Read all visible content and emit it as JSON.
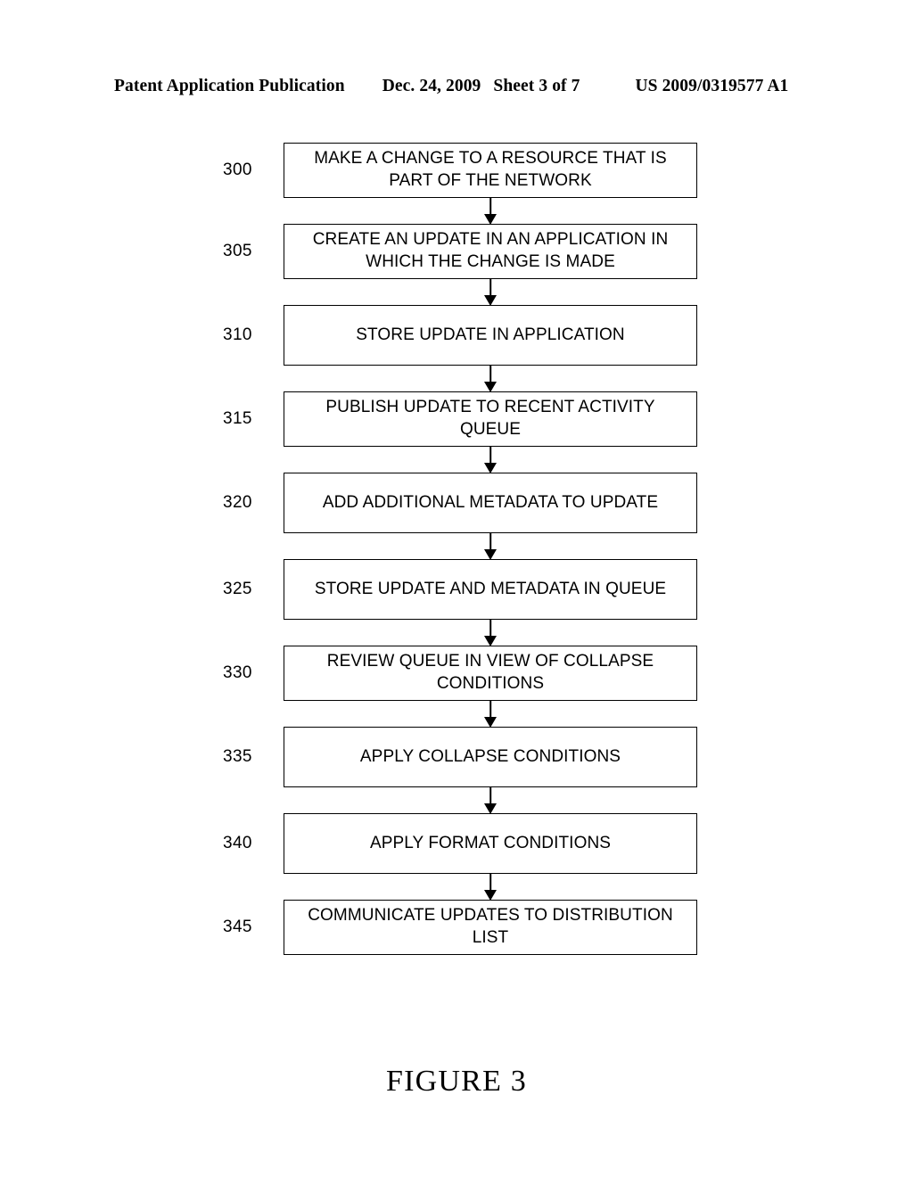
{
  "header": {
    "publication": "Patent Application Publication",
    "date": "Dec. 24, 2009",
    "sheet": "Sheet 3 of 7",
    "patent_number": "US 2009/0319577 A1"
  },
  "figure": {
    "caption": "FIGURE 3"
  },
  "flowchart": {
    "steps": [
      {
        "ref": "300",
        "text": "MAKE A CHANGE TO A RESOURCE THAT IS PART OF THE NETWORK"
      },
      {
        "ref": "305",
        "text": "CREATE AN UPDATE IN AN APPLICATION IN WHICH THE CHANGE IS MADE"
      },
      {
        "ref": "310",
        "text": "STORE UPDATE IN APPLICATION"
      },
      {
        "ref": "315",
        "text": "PUBLISH UPDATE TO RECENT ACTIVITY QUEUE"
      },
      {
        "ref": "320",
        "text": "ADD ADDITIONAL METADATA TO UPDATE"
      },
      {
        "ref": "325",
        "text": "STORE UPDATE AND METADATA IN QUEUE"
      },
      {
        "ref": "330",
        "text": "REVIEW QUEUE IN VIEW OF COLLAPSE CONDITIONS"
      },
      {
        "ref": "335",
        "text": "APPLY COLLAPSE CONDITIONS"
      },
      {
        "ref": "340",
        "text": "APPLY FORMAT CONDITIONS"
      },
      {
        "ref": "345",
        "text": "COMMUNICATE UPDATES TO DISTRIBUTION LIST"
      }
    ]
  },
  "colors": {
    "ink": "#000000",
    "paper": "#ffffff"
  }
}
